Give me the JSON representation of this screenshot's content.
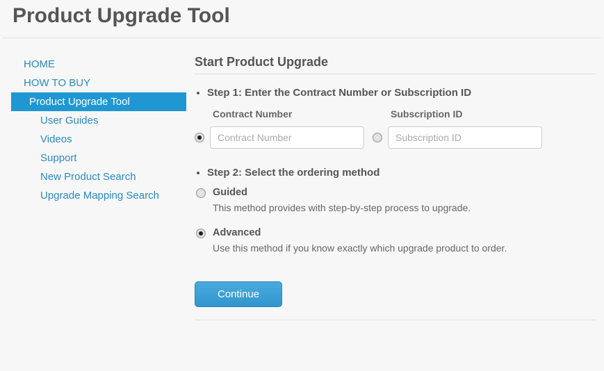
{
  "page": {
    "title": "Product Upgrade Tool"
  },
  "sidebar": {
    "items": [
      {
        "label": "HOME"
      },
      {
        "label": "HOW TO BUY"
      },
      {
        "label": "Product Upgrade Tool"
      },
      {
        "label": "User Guides"
      },
      {
        "label": "Videos"
      },
      {
        "label": "Support"
      },
      {
        "label": "New Product Search"
      },
      {
        "label": "Upgrade Mapping Search"
      }
    ]
  },
  "main": {
    "heading": "Start Product Upgrade",
    "step1": "Step 1: Enter the Contract Number or Subscription ID",
    "contract_label": "Contract Number",
    "contract_placeholder": "Contract Number",
    "subscription_label": "Subscription ID",
    "subscription_placeholder": "Subscription ID",
    "step2": "Step 2: Select the ordering method",
    "guided_name": "Guided",
    "guided_desc": "This method provides with step-by-step process to upgrade.",
    "advanced_name": "Advanced",
    "advanced_desc": "Use this method if you know exactly which upgrade product to order.",
    "continue_label": "Continue"
  }
}
